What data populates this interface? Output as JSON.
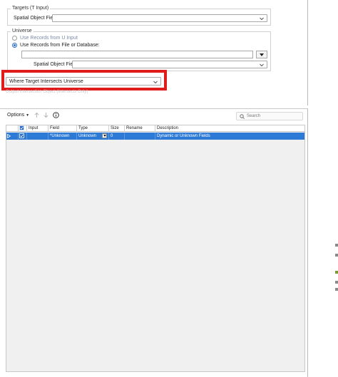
{
  "targets": {
    "title": "Targets (T Input)",
    "spatial_label": "Spatial Object Field:",
    "spatial_value": ""
  },
  "universe": {
    "title": "Universe",
    "option_u_input": "Use Records from U Input",
    "option_file": "Use Records from File or Database:",
    "file_value": "",
    "spatial_label": "Spatial Object Field:",
    "spatial_value": ""
  },
  "relation": {
    "selected": "Where Target Intersects Universe",
    "below_text": "Output Intersection Object (Intersects Only)"
  },
  "toolbar": {
    "options_label": "Options",
    "search_placeholder": "Search"
  },
  "grid": {
    "columns": [
      "Input",
      "Field",
      "Type",
      "Size",
      "Rename",
      "Description"
    ],
    "rows": [
      {
        "field": "*Unknown",
        "type": "Unknown",
        "size": "0",
        "rename": "",
        "description": "Dynamic or Unknown Fields",
        "selected": true
      }
    ]
  },
  "colors": {
    "highlight": "#e01b1b",
    "selection": "#2d7ad6",
    "accent": "#2a6ccf"
  }
}
